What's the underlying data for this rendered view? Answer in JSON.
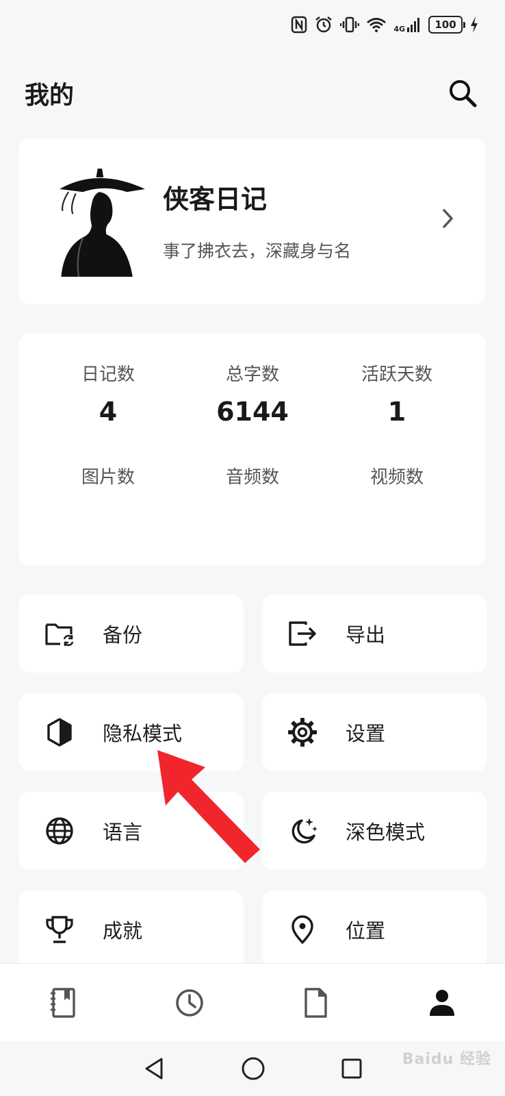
{
  "status_bar": {
    "network": "4G",
    "battery": "100"
  },
  "header": {
    "title": "我的"
  },
  "profile": {
    "name": "侠客日记",
    "bio": "事了拂衣去，深藏身与名"
  },
  "stats": [
    {
      "label": "日记数",
      "value": "4"
    },
    {
      "label": "总字数",
      "value": "6144"
    },
    {
      "label": "活跃天数",
      "value": "1"
    },
    {
      "label": "图片数",
      "value": ""
    },
    {
      "label": "音频数",
      "value": ""
    },
    {
      "label": "视频数",
      "value": ""
    }
  ],
  "menu": [
    {
      "label": "备份",
      "icon": "folder-sync-icon"
    },
    {
      "label": "导出",
      "icon": "export-icon"
    },
    {
      "label": "隐私模式",
      "icon": "privacy-shield-icon"
    },
    {
      "label": "设置",
      "icon": "gear-icon"
    },
    {
      "label": "语言",
      "icon": "globe-icon"
    },
    {
      "label": "深色模式",
      "icon": "moon-stars-icon"
    },
    {
      "label": "成就",
      "icon": "trophy-icon"
    },
    {
      "label": "位置",
      "icon": "location-pin-icon"
    }
  ],
  "bottom_nav": [
    {
      "icon": "diary-book-icon",
      "active": false
    },
    {
      "icon": "clock-icon",
      "active": false
    },
    {
      "icon": "document-icon",
      "active": false
    },
    {
      "icon": "person-icon",
      "active": true
    }
  ],
  "annotation": {
    "arrow_color": "#f0262c"
  },
  "watermark": "Baidu 经验"
}
